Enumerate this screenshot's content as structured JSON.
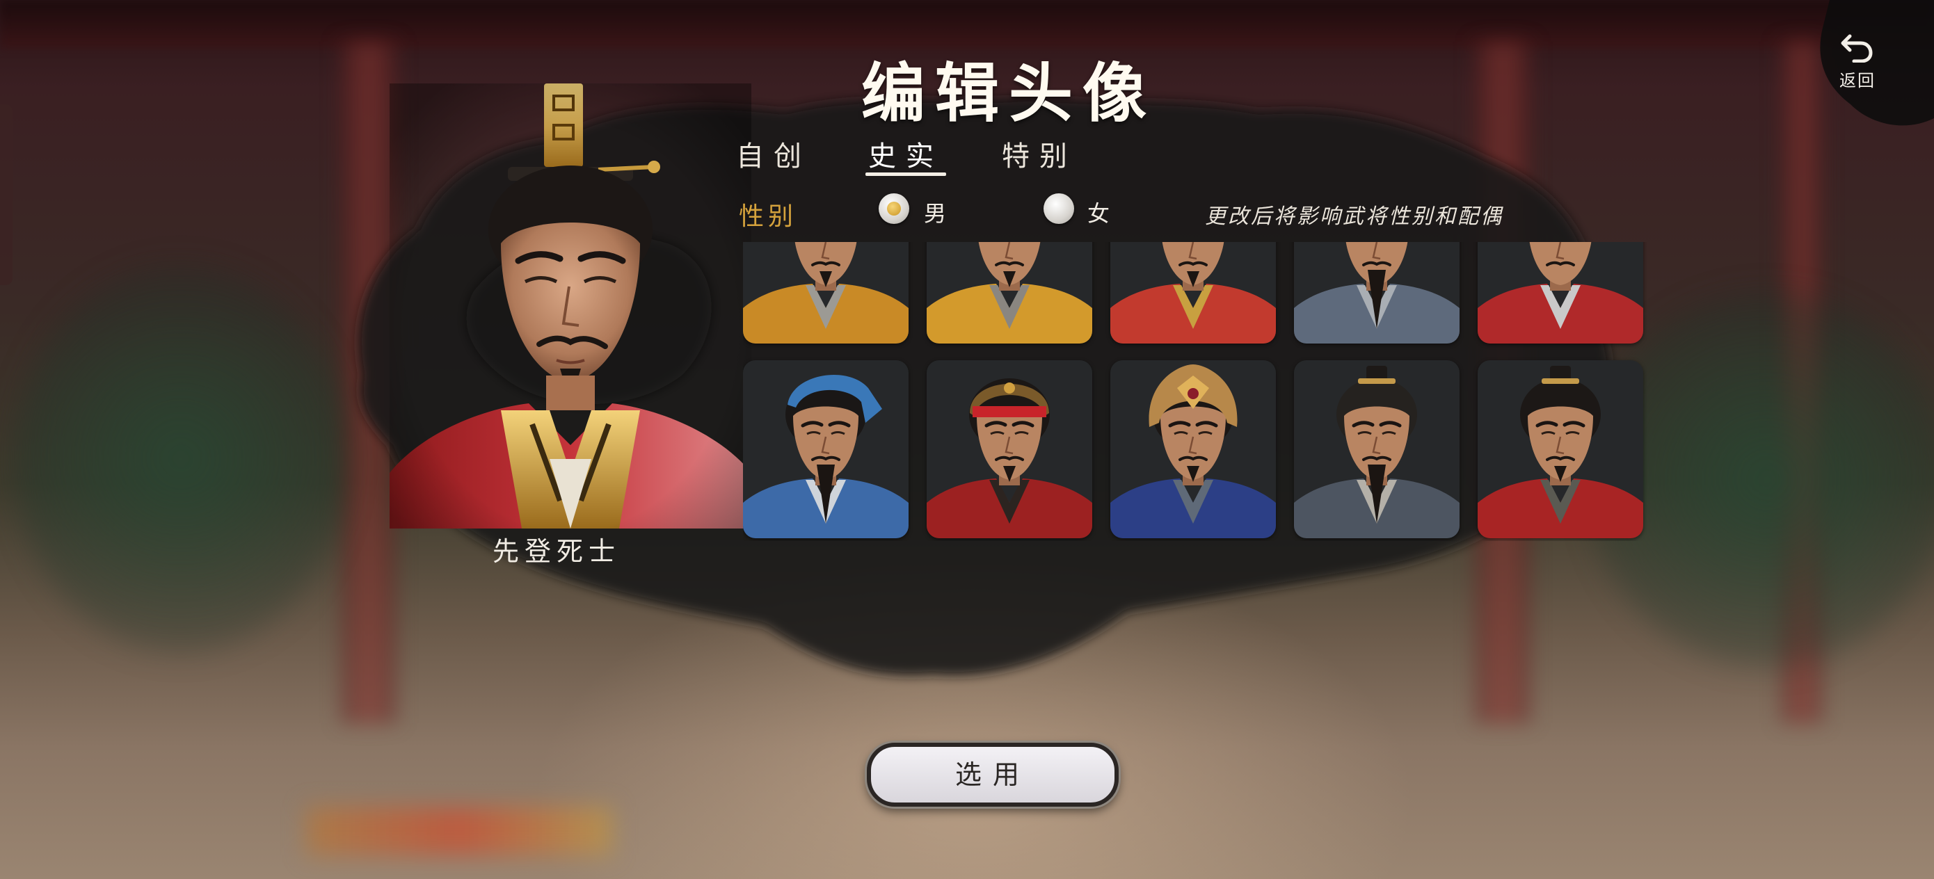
{
  "title": "编辑头像",
  "back": {
    "label": "返回",
    "icon": "return-arrow-icon"
  },
  "tabs": [
    {
      "label": "自创",
      "active": false
    },
    {
      "label": "史实",
      "active": true
    },
    {
      "label": "特别",
      "active": false
    }
  ],
  "gender": {
    "label": "性别",
    "options": [
      {
        "label": "男",
        "selected": true
      },
      {
        "label": "女",
        "selected": false
      }
    ],
    "hint": "更改后将影响武将性别和配偶"
  },
  "selected_portrait": {
    "name": "先登死士"
  },
  "select_button": {
    "label": "选用"
  },
  "colors": {
    "accent_gold": "#d5a23c",
    "title_text": "#fffaf0",
    "button_bg": "#e9e7ec"
  },
  "avatar_grid": {
    "rows": [
      [
        {
          "robe": "#c98a26",
          "inner": "#9c9a94",
          "hair": "#1e1a18",
          "helmet": "none",
          "beard": "short"
        },
        {
          "robe": "#d39a2c",
          "inner": "#8a8680",
          "hair": "#1c1816",
          "helmet": "none",
          "beard": "short"
        },
        {
          "robe": "#c23a2e",
          "inner": "#c8a040",
          "hair": "#1b1716",
          "helmet": "gold",
          "beard": "short"
        },
        {
          "robe": "#5e6a7c",
          "inner": "#a9aeb4",
          "hair": "#1a1715",
          "helmet": "none",
          "beard": "long"
        },
        {
          "robe": "#b0292a",
          "inner": "#c9c9c9",
          "hair": "#1d1917",
          "helmet": "silver",
          "beard": "none"
        }
      ],
      [
        {
          "robe": "#3d6aa8",
          "inner": "#cfd4da",
          "hair": "#1a1716",
          "helmet": "blue-scarf",
          "beard": "long"
        },
        {
          "robe": "#9c2121",
          "inner": "#2c2420",
          "hair": "#1b1715",
          "helmet": "red-band",
          "beard": "short"
        },
        {
          "robe": "#2c3f86",
          "inner": "#5f6a78",
          "hair": "#1b1715",
          "helmet": "gold-silver",
          "beard": "short"
        },
        {
          "robe": "#4d5561",
          "inner": "#b4b0a8",
          "hair": "#25221f",
          "helmet": "topknot",
          "beard": "long"
        },
        {
          "robe": "#a82424",
          "inner": "#5a5a52",
          "hair": "#1c1816",
          "helmet": "topknot",
          "beard": "short"
        }
      ]
    ]
  }
}
